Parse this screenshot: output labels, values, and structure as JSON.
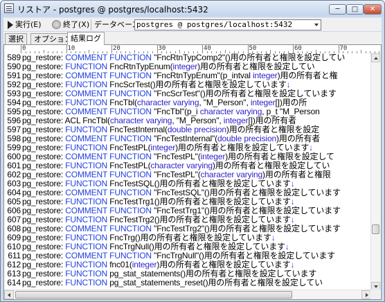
{
  "window": {
    "title": "リストア - postgres @ postgres/localhost:5432",
    "min_label": "─",
    "max_label": "□",
    "close_label": "✕"
  },
  "toolbar": {
    "run_label": "実行(E)",
    "stop_label": "終了(X)",
    "db_label": "データベース",
    "db_value": "postgres @ postgres/localhost:5432"
  },
  "tabs": [
    "選択",
    "オプション",
    "結果ログ"
  ],
  "ruler": [
    "0",
    "10",
    "20",
    "30",
    "40",
    "50",
    "60",
    "70"
  ],
  "log": [
    {
      "no": "589",
      "parts": [
        [
          "t",
          "pg_restore: "
        ],
        [
          "k",
          "COMMENT FUNCTION "
        ],
        [
          "t",
          "\"FncRtnTypComp2\"()用の所有者と権限を設定してい"
        ]
      ]
    },
    {
      "no": "590",
      "parts": [
        [
          "t",
          "pg_restore: "
        ],
        [
          "k",
          "FUNCTION "
        ],
        [
          "t",
          "FncRtnTypEnum("
        ],
        [
          "y",
          "integer"
        ],
        [
          "t",
          ")用の所有者と権限を設定してい"
        ]
      ]
    },
    {
      "no": "591",
      "parts": [
        [
          "t",
          "pg_restore: "
        ],
        [
          "k",
          "COMMENT FUNCTION "
        ],
        [
          "t",
          "\"FncRtnTypEnum\"(p_intval "
        ],
        [
          "y",
          "integer"
        ],
        [
          "t",
          ")用の所有者と権"
        ]
      ]
    },
    {
      "no": "592",
      "parts": [
        [
          "t",
          "pg_restore: "
        ],
        [
          "k",
          "FUNCTION "
        ],
        [
          "t",
          "FncScrTest()用の所有者と権限を設定しています"
        ],
        [
          "e",
          "↓"
        ]
      ]
    },
    {
      "no": "593",
      "parts": [
        [
          "t",
          "pg_restore: "
        ],
        [
          "k",
          "COMMENT FUNCTION "
        ],
        [
          "t",
          "\"FncScrTest\"()用の所有者と権限を設定しています"
        ]
      ]
    },
    {
      "no": "594",
      "parts": [
        [
          "t",
          "pg_restore: "
        ],
        [
          "k",
          "FUNCTION "
        ],
        [
          "t",
          "FncTbl("
        ],
        [
          "y",
          "character varying"
        ],
        [
          "t",
          ", \"M_Person\", "
        ],
        [
          "y",
          "integer"
        ],
        [
          "t",
          "[])用の所"
        ]
      ]
    },
    {
      "no": "595",
      "parts": [
        [
          "t",
          "pg_restore: "
        ],
        [
          "k",
          "COMMENT FUNCTION "
        ],
        [
          "t",
          "\"FncTbl\"(p_i "
        ],
        [
          "y",
          "character varying"
        ],
        [
          "t",
          ", p_t \"M_Person"
        ]
      ]
    },
    {
      "no": "596",
      "parts": [
        [
          "t",
          "pg_restore: "
        ],
        [
          "t",
          "ACL FncTbl("
        ],
        [
          "y",
          "character varying"
        ],
        [
          "t",
          ", \"M_Person\", "
        ],
        [
          "y",
          "integer"
        ],
        [
          "t",
          "[])用の所有者"
        ]
      ]
    },
    {
      "no": "597",
      "parts": [
        [
          "t",
          "pg_restore: "
        ],
        [
          "k",
          "FUNCTION "
        ],
        [
          "t",
          "FncTestInternal("
        ],
        [
          "y",
          "double precision"
        ],
        [
          "t",
          ")用の所有者と権限を設定"
        ]
      ]
    },
    {
      "no": "598",
      "parts": [
        [
          "t",
          "pg_restore: "
        ],
        [
          "k",
          "COMMENT FUNCTION "
        ],
        [
          "t",
          "\"FncTestInternal\"("
        ],
        [
          "y",
          "double precision"
        ],
        [
          "t",
          ")用の所有者"
        ]
      ]
    },
    {
      "no": "599",
      "parts": [
        [
          "t",
          "pg_restore: "
        ],
        [
          "k",
          "FUNCTION "
        ],
        [
          "t",
          "FncTestPL("
        ],
        [
          "y",
          "integer"
        ],
        [
          "t",
          ")用の所有者と権限を設定しています"
        ],
        [
          "e",
          "↓"
        ]
      ]
    },
    {
      "no": "600",
      "parts": [
        [
          "t",
          "pg_restore: "
        ],
        [
          "k",
          "COMMENT FUNCTION "
        ],
        [
          "t",
          "\"FncTestPL\"("
        ],
        [
          "y",
          "integer"
        ],
        [
          "t",
          ")用の所有者と権限を設定して"
        ]
      ]
    },
    {
      "no": "601",
      "parts": [
        [
          "t",
          "pg_restore: "
        ],
        [
          "k",
          "FUNCTION "
        ],
        [
          "t",
          "FncTestPL("
        ],
        [
          "y",
          "character varying"
        ],
        [
          "t",
          ")用の所有者と権限を設定してい"
        ]
      ]
    },
    {
      "no": "602",
      "parts": [
        [
          "t",
          "pg_restore: "
        ],
        [
          "k",
          "COMMENT FUNCTION "
        ],
        [
          "t",
          "\"FncTestPL\"("
        ],
        [
          "y",
          "character varying"
        ],
        [
          "t",
          ")用の所有者と権限"
        ]
      ]
    },
    {
      "no": "603",
      "parts": [
        [
          "t",
          "pg_restore: "
        ],
        [
          "k",
          "FUNCTION "
        ],
        [
          "t",
          "FncTestSQL()用の所有者と権限を設定しています"
        ],
        [
          "e",
          "↓"
        ]
      ]
    },
    {
      "no": "604",
      "parts": [
        [
          "t",
          "pg_restore: "
        ],
        [
          "k",
          "COMMENT FUNCTION "
        ],
        [
          "t",
          "\"FncTestSQL\"()用の所有者と権限を設定しています"
        ]
      ]
    },
    {
      "no": "605",
      "parts": [
        [
          "t",
          "pg_restore: "
        ],
        [
          "k",
          "FUNCTION "
        ],
        [
          "t",
          "FncTestTrg1()用の所有者と権限を設定しています"
        ],
        [
          "e",
          "↓"
        ]
      ]
    },
    {
      "no": "606",
      "parts": [
        [
          "t",
          "pg_restore: "
        ],
        [
          "k",
          "COMMENT FUNCTION "
        ],
        [
          "t",
          "\"FncTestTrg1\"()用の所有者と権限を設定しています"
        ]
      ]
    },
    {
      "no": "607",
      "parts": [
        [
          "t",
          "pg_restore: "
        ],
        [
          "k",
          "FUNCTION "
        ],
        [
          "t",
          "FncTestTrg2()用の所有者と権限を設定しています"
        ],
        [
          "e",
          "↓"
        ]
      ]
    },
    {
      "no": "608",
      "parts": [
        [
          "t",
          "pg_restore: "
        ],
        [
          "k",
          "COMMENT FUNCTION "
        ],
        [
          "t",
          "\"FncTestTrg2\"()用の所有者と権限を設定しています"
        ]
      ]
    },
    {
      "no": "609",
      "parts": [
        [
          "t",
          "pg_restore: "
        ],
        [
          "k",
          "FUNCTION "
        ],
        [
          "t",
          "FncTrg()用の所有者と権限を設定しています"
        ],
        [
          "e",
          "↓"
        ]
      ]
    },
    {
      "no": "610",
      "parts": [
        [
          "t",
          "pg_restore: "
        ],
        [
          "k",
          "FUNCTION "
        ],
        [
          "t",
          "FncTrgNull()用の所有者と権限を設定しています"
        ],
        [
          "e",
          "↓"
        ]
      ]
    },
    {
      "no": "611",
      "parts": [
        [
          "t",
          "pg_restore: "
        ],
        [
          "k",
          "COMMENT FUNCTION "
        ],
        [
          "t",
          "\"FncTrgNull\"()用の所有者と権限を設定しています"
        ]
      ]
    },
    {
      "no": "612",
      "parts": [
        [
          "t",
          "pg_restore: "
        ],
        [
          "k",
          "FUNCTION "
        ],
        [
          "t",
          "fnc01("
        ],
        [
          "y",
          "integer"
        ],
        [
          "t",
          ")用の所有者と権限を設定しています"
        ],
        [
          "e",
          "↓"
        ]
      ]
    },
    {
      "no": "613",
      "parts": [
        [
          "t",
          "pg_restore: "
        ],
        [
          "k",
          "FUNCTION "
        ],
        [
          "t",
          "pg_stat_statements()用の所有者と権限を設定しています"
        ]
      ]
    },
    {
      "no": "614",
      "parts": [
        [
          "t",
          "pg_restore: "
        ],
        [
          "k",
          "FUNCTION "
        ],
        [
          "t",
          "pg_stat_statements_reset()用の所有者と権限を設定してい"
        ]
      ]
    }
  ]
}
